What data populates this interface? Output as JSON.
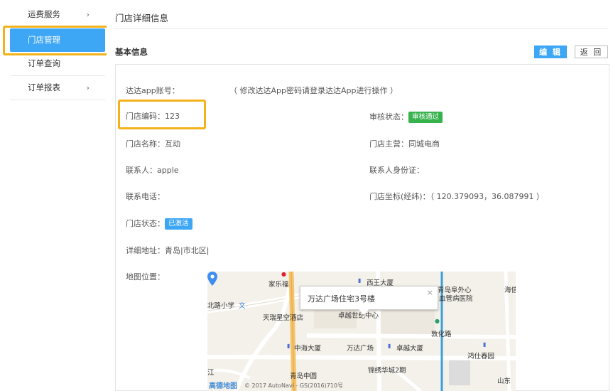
{
  "sidebar": {
    "items": [
      {
        "label": "运费服务",
        "chevron": "›"
      },
      {
        "label": "门店管理",
        "active": true
      },
      {
        "label": "订单查询"
      },
      {
        "label": "订单报表",
        "chevron": "›"
      }
    ]
  },
  "header": {
    "title": "门店详细信息",
    "section_title": "基本信息",
    "edit_label": "编 辑",
    "back_label": "返 回"
  },
  "fields": {
    "account_label": "达达app账号：",
    "account_tip": "（ 修改达达App密码请登录达达App进行操作 ）",
    "store_code": "门店编码：123",
    "audit_label": "审核状态：",
    "audit_badge": "审核通过",
    "store_name": "门店名称：互动",
    "store_business": "门店主营：同城电商",
    "contact": "联系人：apple",
    "contact_id": "联系人身份证：",
    "phone": "联系电话：",
    "coords": "门店坐标(经纬)：（ 120.379093，36.087991 ）",
    "status_label": "门店状态：",
    "status_badge": "已激活",
    "address": "详细地址：青岛|市北区|",
    "map_label": "地图位置："
  },
  "map": {
    "popup_text": "万达广场住宅3号楼",
    "popup_close": "×",
    "logo_text": "高德地图",
    "copyright": "© 2017 AutoNavi - GS(2016)710号",
    "labels": {
      "jialefu": "家乐福",
      "xiwang": "西王大厦",
      "qingdao_hospital": "青岛阜外心",
      "hospital2": "血管病医院",
      "haixin": "海信",
      "school": "北路小学",
      "wen": "文",
      "tianrui": "天瑞星空酒店",
      "zhuoyue_center": "卓越世纪中心",
      "dunhua": "敦化路",
      "zhonghai": "中海大厦",
      "wanda": "万达广场",
      "zhuoyue_building": "卓越大厦",
      "hongshi": "鸿仕春园",
      "jiang": "江",
      "jingxiu": "锦绣华城2期",
      "qingdao_zhongyuan": "青岛中圆",
      "shandong": "山东"
    }
  },
  "colors": {
    "accent": "#3da6f5",
    "highlight": "#f3b21a",
    "success": "#37b24d"
  }
}
